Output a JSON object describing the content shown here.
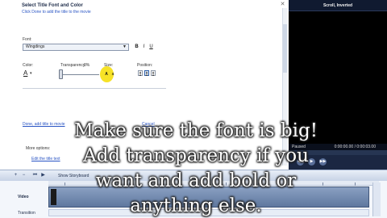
{
  "task_pane": {
    "title": "Select Title Font and Color",
    "subtitle": "Click Done to add the title to the movie",
    "close_symbol": "✕",
    "font_label": "Font:",
    "font_value": "Wingdings",
    "bold_label": "B",
    "italic_label": "I",
    "underline_label": "U",
    "color_label": "Color:",
    "color_glyph": "A",
    "color_dropdown": "▾",
    "transparency_label": "Transparency:",
    "transparency_value": "0%",
    "size_label": "Size:",
    "size_increase": "A",
    "size_decrease": "a",
    "position_label": "Position:",
    "link_edit_title": "Done, add title to movie",
    "link_cancel": "Cancel",
    "more_options_label": "More options:",
    "link_edit_text": "Edit the title text"
  },
  "preview": {
    "title": "Scroll, Inverted",
    "status": "Paused",
    "time": "0:00:00.00 / 0:00:03.00",
    "play_symbol": "▶",
    "prev_symbol": "◀◀",
    "next_symbol": "▶▶"
  },
  "timeline": {
    "show_storyboard": "Show Storyboard",
    "video_label": "Video",
    "transition_label": "Transition",
    "zoom_in_symbol": "+",
    "zoom_out_symbol": "−",
    "rewind_symbol": "⏮",
    "play_symbol": "▶"
  },
  "caption": {
    "text": "Make sure the font is big! Add transparency if you want and add bold or anything else."
  },
  "colors": {
    "accent": "#2a55c4",
    "monitor_bg": "#000000",
    "highlight_cursor": "#f6e01b"
  }
}
